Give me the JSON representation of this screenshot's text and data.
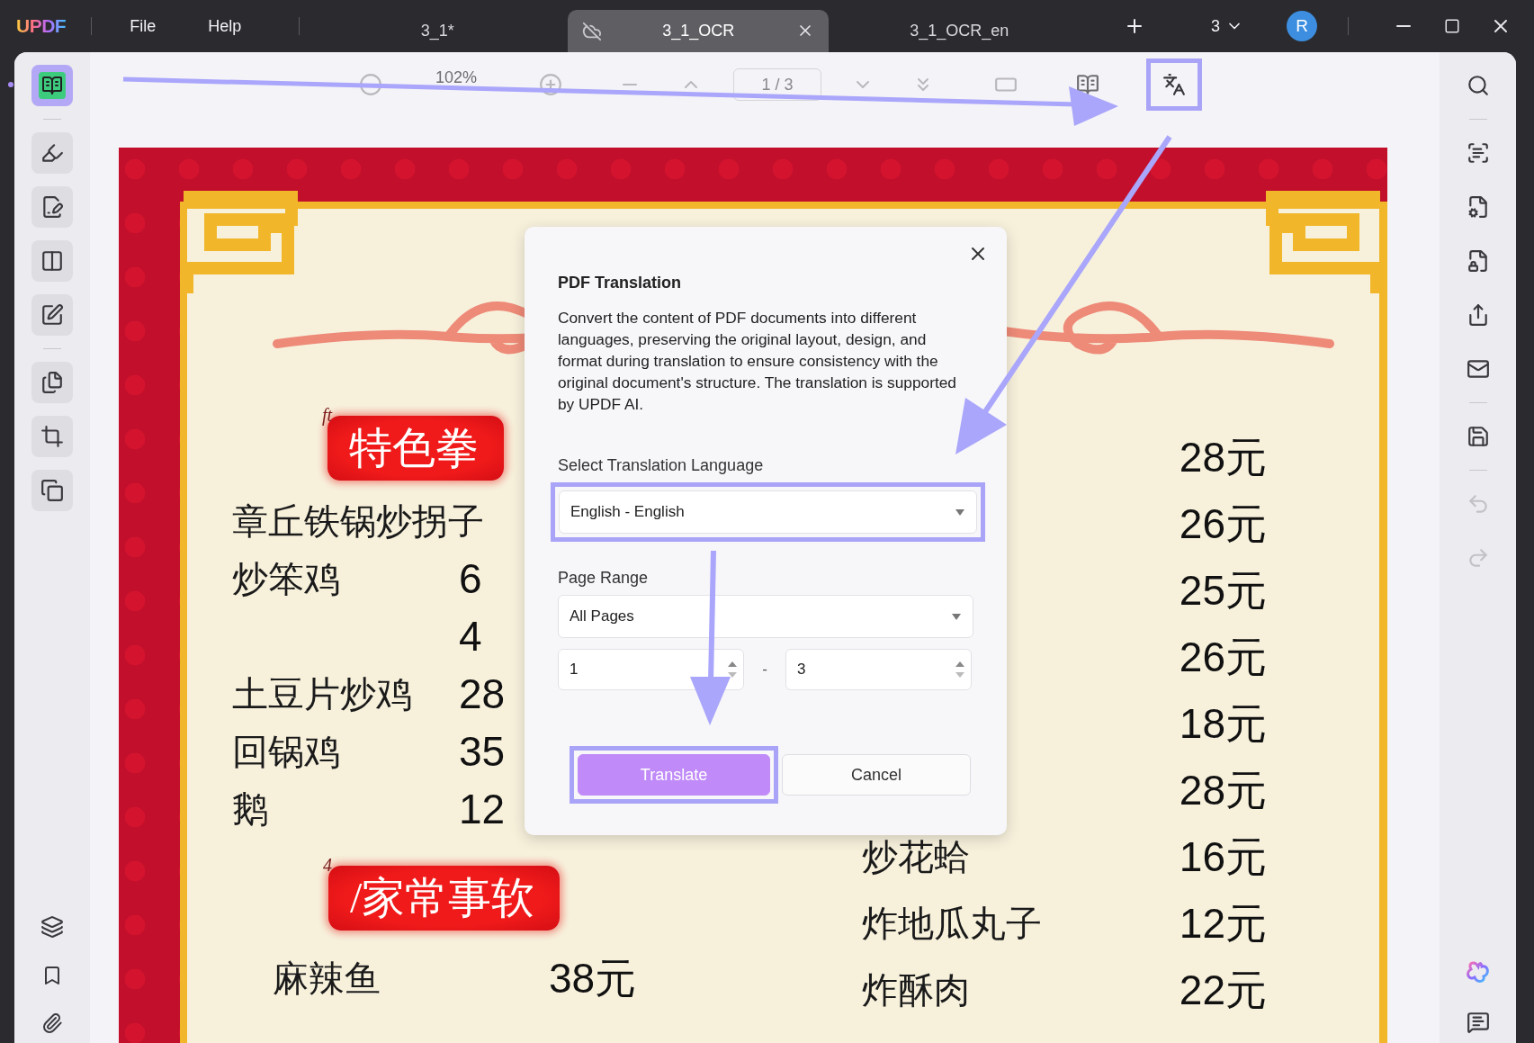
{
  "app": {
    "logo": "UPDF",
    "menus": [
      {
        "label": "File"
      },
      {
        "label": "Help"
      }
    ]
  },
  "tabs": [
    {
      "label": "3_1*",
      "selected": false
    },
    {
      "label": "3_1_OCR",
      "selected": true
    },
    {
      "label": "3_1_OCR_en",
      "selected": false
    }
  ],
  "window_menu": {
    "count": "3",
    "avatar": "R"
  },
  "toolbar": {
    "zoom": "102%",
    "page": "1 / 3",
    "translate_highlighted": true
  },
  "left_tools": [
    {
      "selected": true
    },
    {
      "selected": false
    },
    {
      "selected": false
    },
    {
      "selected": false
    },
    {
      "selected": false
    },
    {
      "selected": false
    },
    {
      "selected": false
    },
    {
      "selected": false
    }
  ],
  "right_tools": [
    {
      "disabled": false
    },
    {
      "disabled": false
    },
    {
      "disabled": false
    },
    {
      "disabled": false
    },
    {
      "disabled": false
    },
    {
      "disabled": false
    },
    {
      "disabled": false
    },
    {
      "disabled": true
    },
    {
      "disabled": true
    }
  ],
  "document": {
    "sections": [
      {
        "mark": "ft",
        "header": "特色拳",
        "items": [
          {
            "name": "章丘铁锅炒拐子"
          },
          {
            "name": "炒笨鸡",
            "price": "6"
          },
          {
            "price": "4"
          },
          {
            "name": "土豆片炒鸡",
            "price": "28"
          },
          {
            "name": "回锅鸡",
            "price": "35"
          },
          {
            "name": "鹅",
            "price": "12"
          }
        ]
      },
      {
        "mark": "4",
        "header": "/家常事软",
        "items": [
          {
            "name": "麻辣鱼",
            "price": "38元"
          }
        ]
      }
    ],
    "right_items": [
      {
        "price": "28元"
      },
      {
        "price": "26元"
      },
      {
        "price": "25元"
      },
      {
        "price": "26元"
      },
      {
        "price": "18元"
      },
      {
        "price": "28元"
      },
      {
        "name": "炒花蛤",
        "price": "16元"
      },
      {
        "name": "炸地瓜丸子",
        "price": "12元"
      },
      {
        "name": "炸酥肉",
        "price": "22元"
      }
    ]
  },
  "dialog": {
    "title": "PDF Translation",
    "description": "Convert the content of PDF documents into different languages, preserving the original layout, design, and format during translation to ensure consistency with the original document's structure. The translation is supported by UPDF AI.",
    "language": {
      "label": "Select Translation Language",
      "value": "English - English",
      "highlighted": true
    },
    "range": {
      "label": "Page Range",
      "value": "All Pages",
      "from": "1",
      "separator": "-",
      "to": "3"
    },
    "buttons": [
      {
        "label": "Translate",
        "kind": "primary",
        "highlighted": true
      },
      {
        "label": "Cancel",
        "kind": "secondary",
        "highlighted": false
      }
    ]
  }
}
